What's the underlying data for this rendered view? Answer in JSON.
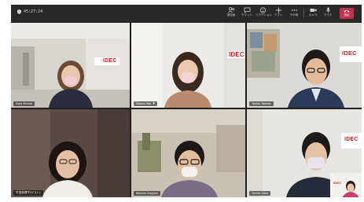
{
  "toolbar": {
    "timer": "45:27:24",
    "buttons": [
      {
        "label": "参加者",
        "icon": "people-icon"
      },
      {
        "label": "チャット",
        "icon": "chat-icon"
      },
      {
        "label": "リアクション",
        "icon": "reaction-icon"
      },
      {
        "label": "アプリ",
        "icon": "apps-icon"
      },
      {
        "label": "その他",
        "icon": "more-icon"
      },
      {
        "label": "カメラ",
        "icon": "camera-icon"
      },
      {
        "label": "マイク",
        "icon": "mic-icon"
      },
      {
        "label": "共有",
        "icon": "share-icon"
      }
    ],
    "leave_label": "退出",
    "colors": {
      "bar": "#292929",
      "leave": "#c4314b"
    }
  },
  "participants": [
    {
      "name": "Yuka Mariko",
      "logo": "IDEC"
    },
    {
      "name": "Yukino Yae",
      "logo": "IDEC"
    },
    {
      "name": "Toshio Takeda",
      "logo": "IDEC"
    },
    {
      "name": "竹田真理子(ゲスト)",
      "logo": ""
    },
    {
      "name": "Makoto Ikegami",
      "logo": ""
    },
    {
      "name": "Yoshio Goto",
      "logo": "IDEC"
    }
  ],
  "self_view": {
    "logo": "IDEC"
  },
  "brand_color": "#d2232a"
}
